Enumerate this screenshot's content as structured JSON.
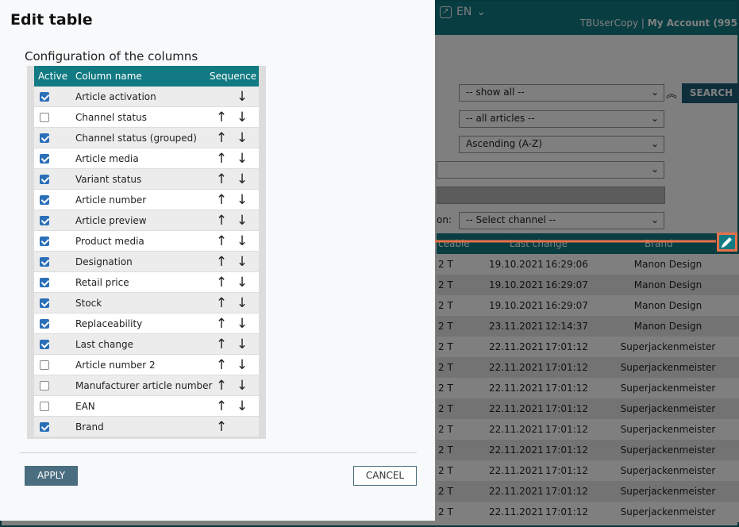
{
  "header": {
    "lang": "EN",
    "user": "TBUserCopy",
    "separator": "|",
    "account": "My Account (995"
  },
  "filters": {
    "show_all": "-- show all --",
    "all_articles": "-- all articles --",
    "sort": "Ascending (A-Z)",
    "channel_label": "on:",
    "channel": "-- Select channel --",
    "search_label": "SEARCH"
  },
  "results_table": {
    "headers": [
      "ceable",
      "Last change",
      "Brand"
    ],
    "rows": [
      {
        "rep": "2 T",
        "date": "19.10.2021",
        "time": "16:29:06",
        "brand": "Manon Design"
      },
      {
        "rep": "2 T",
        "date": "19.10.2021",
        "time": "16:29:07",
        "brand": "Manon Design"
      },
      {
        "rep": "2 T",
        "date": "19.10.2021",
        "time": "16:29:07",
        "brand": "Manon Design"
      },
      {
        "rep": "2 T",
        "date": "23.11.2021",
        "time": "12:14:37",
        "brand": "Manon Design"
      },
      {
        "rep": "2 T",
        "date": "22.11.2021",
        "time": "17:01:12",
        "brand": "Superjackenmeister"
      },
      {
        "rep": "2 T",
        "date": "22.11.2021",
        "time": "17:01:12",
        "brand": "Superjackenmeister"
      },
      {
        "rep": "2 T",
        "date": "22.11.2021",
        "time": "17:01:12",
        "brand": "Superjackenmeister"
      },
      {
        "rep": "2 T",
        "date": "22.11.2021",
        "time": "17:01:12",
        "brand": "Superjackenmeister"
      },
      {
        "rep": "2 T",
        "date": "22.11.2021",
        "time": "17:01:12",
        "brand": "Superjackenmeister"
      },
      {
        "rep": "2 T",
        "date": "22.11.2021",
        "time": "17:01:12",
        "brand": "Superjackenmeister"
      },
      {
        "rep": "2 T",
        "date": "22.11.2021",
        "time": "17:01:12",
        "brand": "Superjackenmeister"
      },
      {
        "rep": "2 T",
        "date": "22.11.2021",
        "time": "17:01:12",
        "brand": "Superjackenmeister"
      },
      {
        "rep": "2 T",
        "date": "22.11.2021",
        "time": "17:01:12",
        "brand": "Superjackenmeister"
      }
    ]
  },
  "modal": {
    "title": "Edit table",
    "config_title": "Configuration of the columns",
    "headers": {
      "active": "Active",
      "column": "Column name",
      "sequence": "Sequence"
    },
    "columns": [
      {
        "name": "Article activation",
        "active": true,
        "up": false,
        "down": true
      },
      {
        "name": "Channel status",
        "active": false,
        "up": true,
        "down": true
      },
      {
        "name": "Channel status (grouped)",
        "active": true,
        "up": true,
        "down": true
      },
      {
        "name": "Article media",
        "active": true,
        "up": true,
        "down": true
      },
      {
        "name": "Variant status",
        "active": true,
        "up": true,
        "down": true
      },
      {
        "name": "Article number",
        "active": true,
        "up": true,
        "down": true
      },
      {
        "name": "Article preview",
        "active": true,
        "up": true,
        "down": true
      },
      {
        "name": "Product media",
        "active": true,
        "up": true,
        "down": true
      },
      {
        "name": "Designation",
        "active": true,
        "up": true,
        "down": true
      },
      {
        "name": "Retail price",
        "active": true,
        "up": true,
        "down": true
      },
      {
        "name": "Stock",
        "active": true,
        "up": true,
        "down": true
      },
      {
        "name": "Replaceability",
        "active": true,
        "up": true,
        "down": true
      },
      {
        "name": "Last change",
        "active": true,
        "up": true,
        "down": true
      },
      {
        "name": "Article number 2",
        "active": false,
        "up": true,
        "down": true
      },
      {
        "name": "Manufacturer article number",
        "active": false,
        "up": true,
        "down": true
      },
      {
        "name": "EAN",
        "active": false,
        "up": true,
        "down": true
      },
      {
        "name": "Brand",
        "active": true,
        "up": true,
        "down": false
      }
    ],
    "apply_label": "APPLY",
    "cancel_label": "CANCEL"
  },
  "colors": {
    "teal": "#117a82",
    "annotation": "#e8704a",
    "button": "#4a6d80"
  }
}
